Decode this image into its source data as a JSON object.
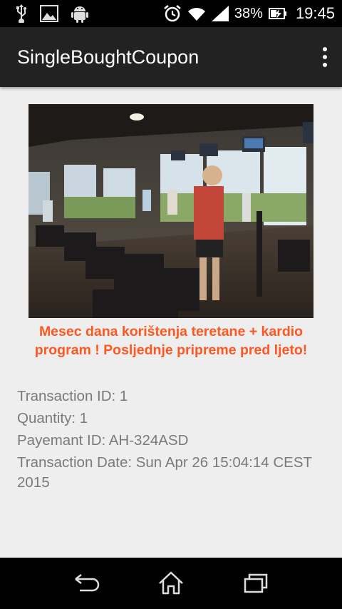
{
  "status_bar": {
    "battery_percent": "38%",
    "time": "19:45",
    "icons": [
      "usb-icon",
      "image-icon",
      "android-icon",
      "alarm-icon",
      "wifi-icon",
      "signal-icon",
      "battery-charging-icon"
    ]
  },
  "action_bar": {
    "title": "SingleBoughtCoupon",
    "overflow_icon": "overflow-menu-icon"
  },
  "coupon": {
    "title": "Mesec dana korištenja teretane + kardio program ! Posljednje pripreme pred ljeto!",
    "title_color": "#ff5722",
    "image_alt": "gym-treadmills-photo"
  },
  "details": {
    "transaction_id": "Transaction ID: 1",
    "quantity": "Quantity: 1",
    "payment_id": "Payemant ID: AH-324ASD",
    "transaction_date": "Transaction Date: Sun Apr 26 15:04:14 CEST 2015"
  },
  "nav_bar": {
    "back_icon": "back-icon",
    "home_icon": "home-icon",
    "recents_icon": "recent-apps-icon"
  }
}
